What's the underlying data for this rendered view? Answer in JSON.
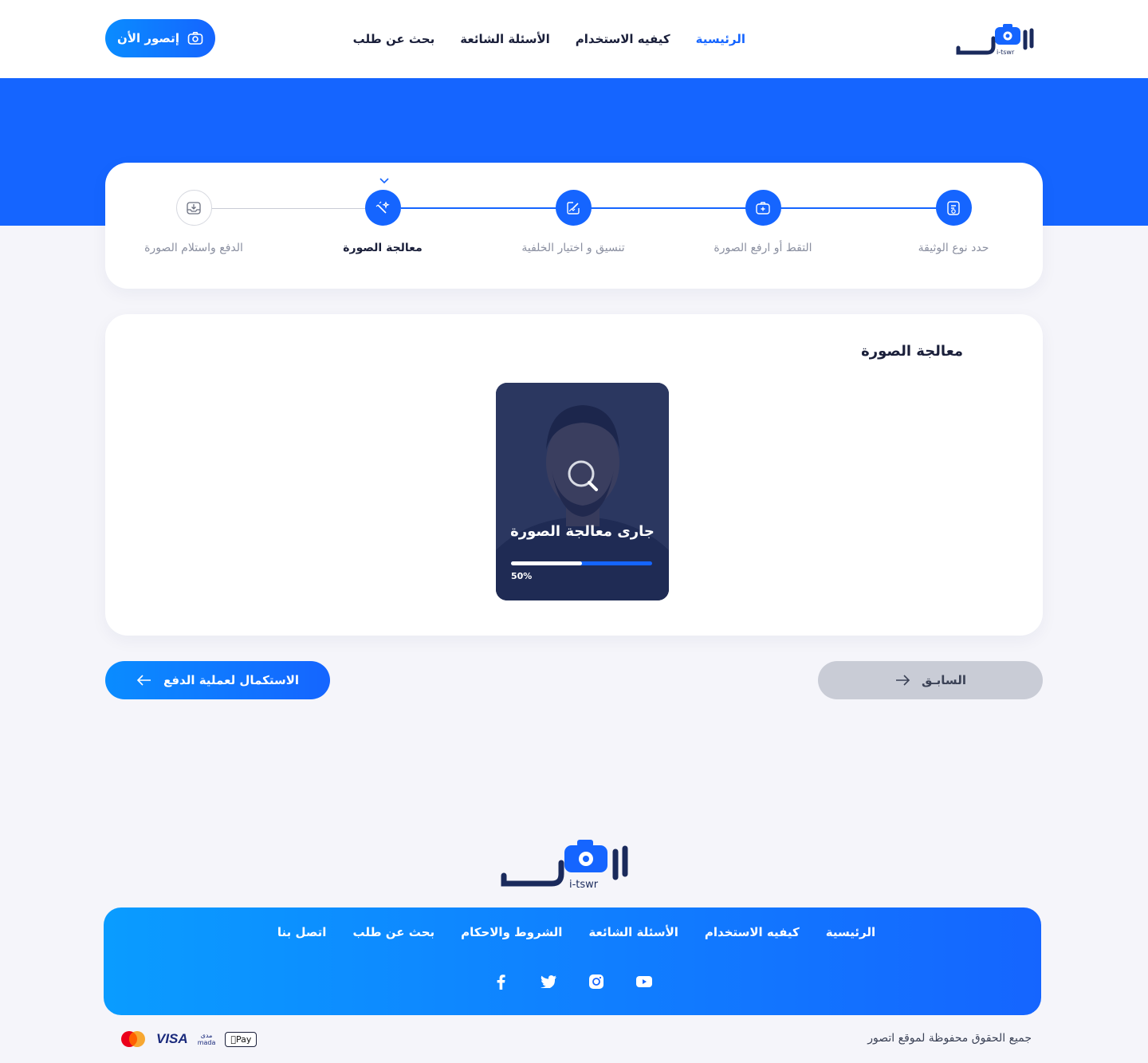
{
  "header": {
    "logo_text": "إتصوّر",
    "logo_sub": "i-tswr",
    "nav": [
      "الرئيسية",
      "كيفيه الاستخدام",
      "الأسئلة الشائعة",
      "بحث عن طلب"
    ],
    "cta": "إتصور الأن"
  },
  "stepper": {
    "steps": [
      "حدد نوع الوثيقة",
      "التقط أو ارفع الصورة",
      "تنسيق و اختيار الخلفية",
      "معالجة الصورة",
      "الدفع واستلام الصورة"
    ],
    "current_index": 3
  },
  "processing": {
    "title": "معالجة الصورة",
    "status_text": "جارى معالجة الصورة",
    "progress_fraction": 0.5,
    "progress_label": "50%"
  },
  "actions": {
    "next": "الاستكمال لعملية الدفع",
    "prev": "السابـق"
  },
  "footer": {
    "nav": [
      "الرئيسية",
      "كيفيه الاستخدام",
      "الأسئلة الشائعة",
      "الشروط والاحكام",
      "بحث عن طلب",
      "اتصل بنا"
    ],
    "socials": [
      "youtube-icon",
      "instagram-icon",
      "twitter-icon",
      "facebook-icon"
    ],
    "copyright": "جميع الحقوق محفوظة لموقع اتصور",
    "payments": {
      "visa": "VISA",
      "mada_ar": "مدى",
      "mada_en": "mada",
      "apple": "Pay"
    }
  },
  "colors": {
    "primary": "#1565ff",
    "gradient_start": "#0a8cff",
    "background": "#f5f5fa",
    "text": "#1a1f3a"
  }
}
